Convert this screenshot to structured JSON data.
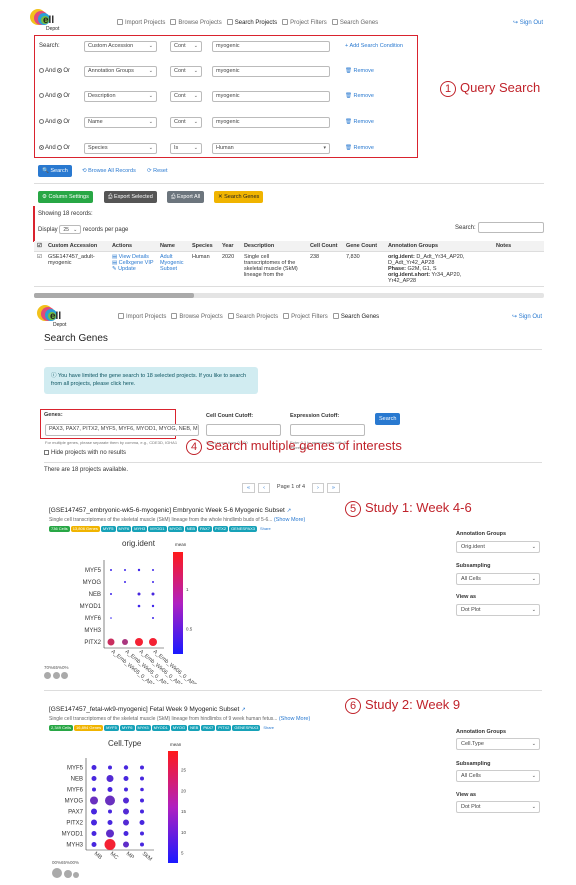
{
  "top_nav": {
    "items": [
      "Import Projects",
      "Browse Projects",
      "Search Projects",
      "Project Filters",
      "Search Genes"
    ],
    "sign_out": "Sign Out"
  },
  "logo": {
    "text": "Cell Depot"
  },
  "query": {
    "search_label": "Search:",
    "add_condition": "Add Search Condition",
    "remove": "Remove",
    "and_label": "And",
    "or_label": "Or",
    "rows": [
      {
        "field": "Custom Accession",
        "op": "Cont",
        "value": "myogenic",
        "logic": null
      },
      {
        "field": "Annotation Groups",
        "op": "Cont",
        "value": "myogenic",
        "logic": "or"
      },
      {
        "field": "Description",
        "op": "Cont",
        "value": "myogenic",
        "logic": "or"
      },
      {
        "field": "Name",
        "op": "Cont",
        "value": "myogenic",
        "logic": "or"
      },
      {
        "field": "Species",
        "op": "Is",
        "value": "Human",
        "logic": "and"
      }
    ],
    "search_button": "Search",
    "browse_all": "Browse All Records",
    "reset": "Reset"
  },
  "annotations": {
    "a1": {
      "num": "1",
      "text": "Query Search"
    },
    "a4": {
      "num": "4",
      "text": "Search multiple genes of interests"
    },
    "a5": {
      "num": "5",
      "text": "Study 1: Week 4-6"
    },
    "a6": {
      "num": "6",
      "text": "Study 2: Week 9"
    }
  },
  "toolbar": {
    "column_settings": "Column Settings",
    "export_selected": "Export Selected",
    "export_all": "Export All",
    "search_genes": "Search Genes"
  },
  "results": {
    "showing": "Showing 18 records:",
    "display": "Display",
    "per_page_value": "25",
    "records_per_page": "records per page",
    "search_label": "Search:",
    "columns": [
      "Custom Accession",
      "Actions",
      "Name",
      "Species",
      "Year",
      "Description",
      "Cell Count",
      "Gene Count",
      "Annotation Groups",
      "Notes"
    ],
    "row": {
      "accession": "GSE147457_adult-myogenic",
      "actions": [
        "View Details",
        "Cellxgene VIP",
        "Update"
      ],
      "name": "Adult Myogenic Subset",
      "species": "Human",
      "year": "2020",
      "description": "Single cell transcriptomes of the skeletal muscle (SkM) lineage from the",
      "cell_count": "238",
      "gene_count": "7,830",
      "groups": [
        {
          "k": "orig.ident:",
          "v": "D_Adt_Yr34_AP20, D_Adt_Yr42_AP28"
        },
        {
          "k": "Phase:",
          "v": "G2M, G1, S"
        },
        {
          "k": "orig.ident.short:",
          "v": "Yr34_AP20, Yr42_AP28"
        }
      ]
    }
  },
  "gene_search": {
    "title": "Search Genes",
    "info": "You have limited the gene search to 18 selected projects. If you like to search from all projects, please click here.",
    "info_link": "here",
    "genes_label": "Genes:",
    "genes_value": "PAX3, PAX7, PITX2, MYF5, MYF6, MYOD1, MYOG, NEB, M",
    "genes_help": "For multiple genes, please separate them by comma, e.g., CDE3D, IGHA1",
    "cell_cutoff_label": "Cell Count Cutoff:",
    "cell_cutoff_help": "It can range from 0-100",
    "expr_cutoff_label": "Expression Cutoff:",
    "expr_cutoff_help": "Enter 0.1 to remove cells with 0 expression",
    "search_button": "Search",
    "hide_label": "Hide projects with no results",
    "available": "There are 18 projects available.",
    "pager": {
      "first": "«",
      "prev": "‹",
      "page": "Page 1 of 4",
      "next": "›",
      "last": "»"
    }
  },
  "study1": {
    "title": "[GSE147457_embryonic-wk5-6-myogenic] Embryonic Week 5-6 Myogenic Subset",
    "desc": "Single cell transcriptomes of the skeletal muscle (SkM) lineage from the whole hindlimb buds of 5-6...",
    "show_more": "(Show More)",
    "badges": [
      "736 Cells",
      "13,806 Genes",
      "MYF5",
      "MYF6",
      "MYH3",
      "MYOD1",
      "MYOG",
      "NEB",
      "PAX7",
      "PITX2",
      "GENESPAX3",
      "Share"
    ],
    "chart_title": "orig.ident",
    "legend_title": "mean",
    "colorbar_ticks": [
      "1",
      "0.5"
    ],
    "genes": [
      "MYF5",
      "MYOG",
      "NEB",
      "MYOD1",
      "MYF6",
      "MYH3",
      "PITX2"
    ],
    "x_labels": [
      "A_Emb_Wk05_0_AP12",
      "A_Emb_Wk05_0_AP17",
      "A_Emb_Wk06_0_AP13",
      "A_Emb_Wk06_0_AP5"
    ],
    "size_legend": [
      "70%",
      "65%",
      "0%"
    ],
    "controls": {
      "annotation_groups": "Annotation Groups",
      "annotation_value": "Orig.ident",
      "subsampling": "Subsampling",
      "subsampling_value": "All Cells",
      "view_as": "View as",
      "view_value": "Dot Plot"
    }
  },
  "study2": {
    "title": "[GSE147457_fetal-wk9-myogenic] Fetal Week 9 Myogenic Subset",
    "desc": "Single cell transcriptomes of the skeletal muscle (SkM) lineage from hindlimbs of 9 week human fetus...",
    "show_more": "(Show More)",
    "badges": [
      "2,349 Cells",
      "16,894 Genes",
      "MYF5",
      "MYF6",
      "MYH3",
      "MYOD1",
      "MYOG",
      "NEB",
      "PAX7",
      "PITX2",
      "GENESPAX3",
      "Share"
    ],
    "chart_title": "Cell.Type",
    "legend_title": "mean",
    "colorbar_ticks": [
      "25",
      "20",
      "15",
      "10",
      "5"
    ],
    "genes": [
      "MYF5",
      "NEB",
      "MYF6",
      "MYOG",
      "PAX7",
      "PITX2",
      "MYOD1",
      "MYH3"
    ],
    "x_labels": [
      "MB",
      "MC",
      "MP",
      "SkM"
    ],
    "size_legend": [
      "00%",
      "65%",
      "00%"
    ],
    "controls": {
      "annotation_groups": "Annotation Groups",
      "annotation_value": "Cell.Type",
      "subsampling": "Subsampling",
      "subsampling_value": "All Cells",
      "view_as": "View as",
      "view_value": "Dot Plot"
    }
  },
  "colors": {
    "accent": "#2979d0",
    "annot": "#c0232b",
    "green": "#28a745",
    "yellow": "#f0b400",
    "grey": "#6c757d"
  }
}
